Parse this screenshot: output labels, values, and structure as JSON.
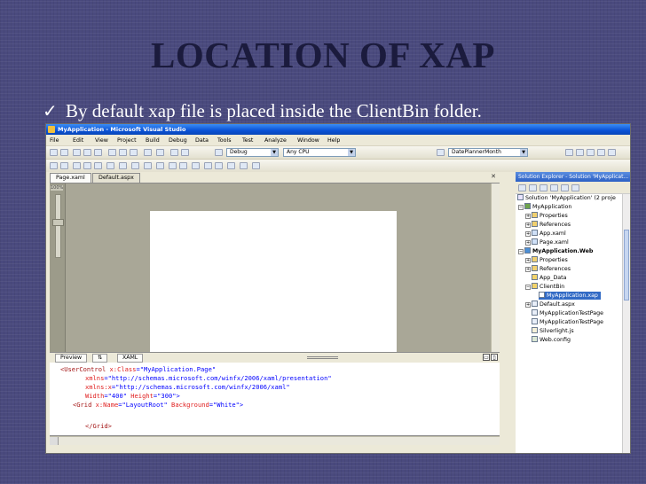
{
  "slide": {
    "title": "LOCATION OF XAP",
    "bullet": "By default xap file is placed inside the ClientBin folder."
  },
  "window": {
    "title": "MyApplication - Microsoft Visual Studio",
    "menu": [
      "File",
      "Edit",
      "View",
      "Project",
      "Build",
      "Debug",
      "Data",
      "Tools",
      "Test",
      "Analyze",
      "Window",
      "Help"
    ],
    "toolbar": {
      "config": "Debug",
      "platform": "Any CPU",
      "find": "DatePlannerMonth"
    }
  },
  "editor": {
    "tabs": [
      "Page.xaml",
      "Default.aspx"
    ],
    "zoom": "100%",
    "split_tabs": [
      "Preview",
      "⇅",
      "XAML"
    ],
    "code": {
      "l1a": "<UserControl ",
      "l1b": "x:Class",
      "l1c": "=\"MyApplication.Page\"",
      "l2a": "xmlns",
      "l2b": "=\"http://schemas.microsoft.com/winfx/2006/xaml/presentation\"",
      "l3a": "xmlns:x",
      "l3b": "=\"http://schemas.microsoft.com/winfx/2006/xaml\"",
      "l4a": "Width",
      "l4b": "=\"400\" ",
      "l4c": "Height",
      "l4d": "=\"300\">",
      "l5a": "<Grid ",
      "l5b": "x:Name",
      "l5c": "=\"LayoutRoot\" ",
      "l5d": "Background",
      "l5e": "=\"White\">",
      "l6": "</Grid>"
    }
  },
  "solution_explorer": {
    "title": "Solution Explorer - Solution 'MyApplicat...",
    "nodes": [
      "Solution 'MyApplication' (2 proje",
      "MyApplication",
      "Properties",
      "References",
      "App.xaml",
      "Page.xaml",
      "MyApplication.Web",
      "Properties",
      "References",
      "App_Data",
      "ClientBin",
      "MyApplication.xap",
      "Default.aspx",
      "MyApplicationTestPage",
      "MyApplicationTestPage",
      "Silverlight.js",
      "Web.config"
    ]
  }
}
